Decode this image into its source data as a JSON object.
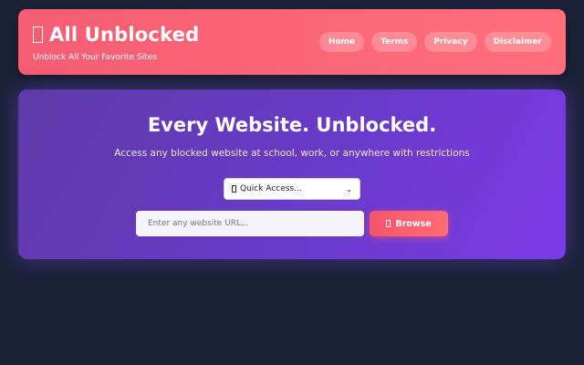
{
  "header": {
    "title": "All Unblocked",
    "tagline": "Unblock All Your Favorite Sites",
    "nav": [
      {
        "label": "Home"
      },
      {
        "label": "Terms"
      },
      {
        "label": "Privacy"
      },
      {
        "label": "Disclaimer"
      }
    ]
  },
  "hero": {
    "title": "Every Website. Unblocked.",
    "subtitle": "Access any blocked website at school, work, or anywhere with restrictions",
    "quick_access": {
      "selected": "Quick Access..."
    },
    "url_input": {
      "placeholder": "Enter any website URL...",
      "value": ""
    },
    "browse_label": "Browse"
  },
  "colors": {
    "background": "#1b2238",
    "header_accent": "#f45d73",
    "hero_accent": "#6a3ac9",
    "button_accent": "#f4566d"
  }
}
